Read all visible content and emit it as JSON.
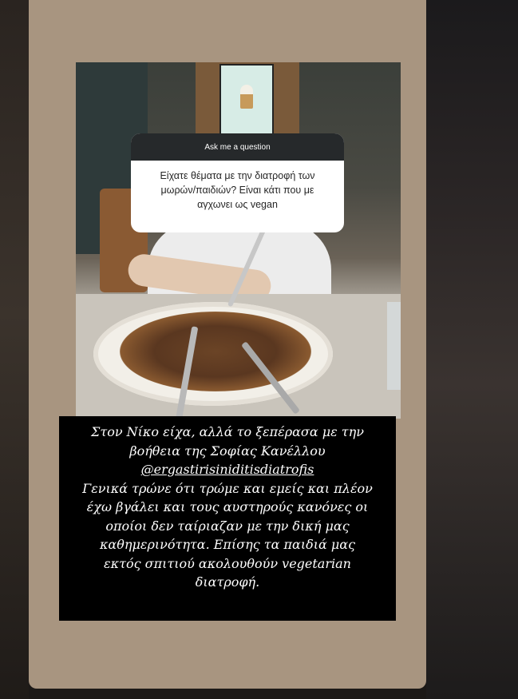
{
  "question_sticker": {
    "header": "Ask me a question",
    "question": "Είχατε θέματα με την διατροφή των μωρών/παιδιών? Είναι κάτι που με αγχωνει ως vegan"
  },
  "answer": {
    "lines": [
      "Στον Νίκο είχα, αλλά το ξεπέρασα με την",
      "βοήθεια της Σοφίας Κανέλλου",
      "@ergastirisiniditisdiatrofis",
      "Γενικά τρώνε ότι τρώμε και εμείς και πλέον",
      "έχω βγάλει και τους αυστηρούς κανόνες οι",
      "οποίοι δεν ταίριαζαν με την δική μας",
      "καθημερινότητα. Επίσης τα παιδιά μας",
      "εκτός σπιτιού ακολουθούν vegetarian",
      "διατροφή."
    ]
  },
  "colors": {
    "card_background": "#a89580",
    "sticker_header": "#26292b",
    "answer_background": "#000000"
  }
}
